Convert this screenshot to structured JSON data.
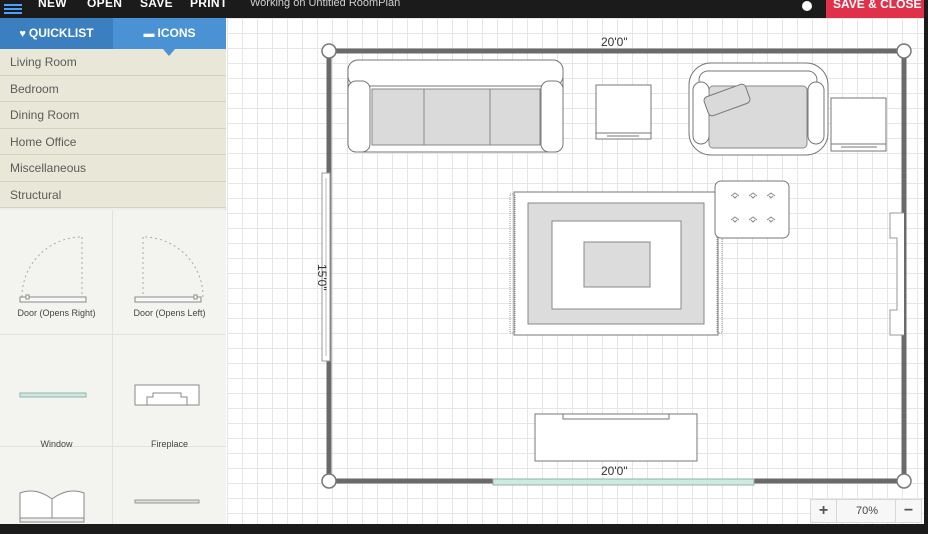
{
  "topbar": {
    "menu": [
      {
        "label": "NEW",
        "name": "menu-new"
      },
      {
        "label": "OPEN",
        "name": "menu-open"
      },
      {
        "label": "SAVE",
        "name": "menu-save"
      },
      {
        "label": "PRINT",
        "name": "menu-print"
      }
    ],
    "status": "Working on Untitled RoomPlan",
    "save_close_label": "SAVE & CLOSE"
  },
  "sidebar": {
    "tabs": [
      {
        "label": "QUICKLIST",
        "icon": "heart-icon"
      },
      {
        "label": "ICONS",
        "icon": "sofa-icon"
      }
    ],
    "categories": [
      "Living Room",
      "Bedroom",
      "Dining Room",
      "Home Office",
      "Miscellaneous",
      "Structural"
    ],
    "icons": [
      {
        "label": "Door (Opens Right)",
        "icon": "door-opens-right-icon"
      },
      {
        "label": "Door (Opens Left)",
        "icon": "door-opens-left-icon"
      },
      {
        "label": "Window",
        "icon": "window-icon"
      },
      {
        "label": "Fireplace",
        "icon": "fireplace-icon"
      },
      {
        "label": "",
        "icon": "double-door-icon"
      },
      {
        "label": "",
        "icon": "wall-icon"
      }
    ]
  },
  "plan": {
    "dim_top": "20'0\"",
    "dim_bottom": "20'0\"",
    "dim_left": "15'0\""
  },
  "zoom": {
    "plus": "+",
    "level": "70%",
    "minus": "−"
  },
  "colors": {
    "topbar": "#1b1b1b",
    "save_close": "#e0314b",
    "tab_blue": "#3d85c6",
    "wall": "#666666",
    "window_tint": "#cfe9e2"
  }
}
